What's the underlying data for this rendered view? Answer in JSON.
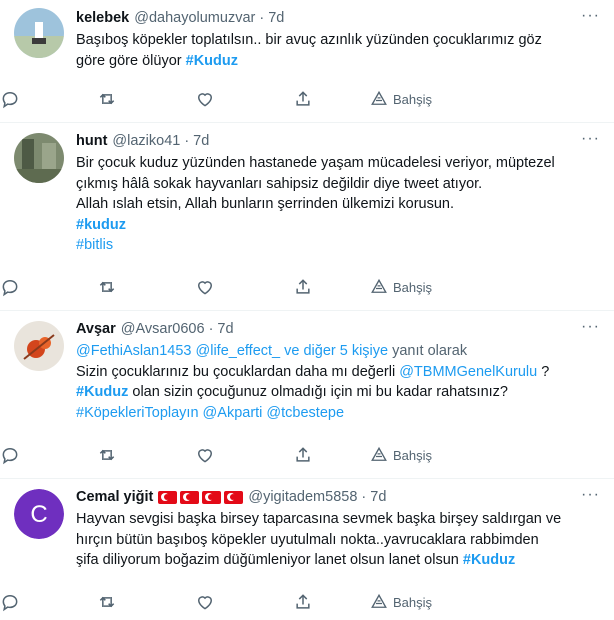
{
  "tweets": [
    {
      "name": "kelebek",
      "handle": "@dahayolumuzvar",
      "time": "7d",
      "lines": [
        [
          {
            "t": "Başıboş köpekler toplatılsın.. bir avuç azınlık yüzünden çocuklarımız göz"
          }
        ],
        [
          {
            "t": "göre göre ölüyor "
          },
          {
            "t": "#Kuduz",
            "link": true,
            "bold": true
          }
        ]
      ]
    },
    {
      "name": "hunt",
      "handle": "@laziko41",
      "time": "7d",
      "lines": [
        [
          {
            "t": "Bir çocuk kuduz yüzünden hastanede yaşam mücadelesi veriyor, müptezel"
          }
        ],
        [
          {
            "t": "çıkmış hâlâ sokak hayvanları sahipsiz değildir diye tweet atıyor."
          }
        ],
        [
          {
            "t": "Allah ıslah etsin, Allah bunların şerrinden ülkemizi korusun."
          }
        ],
        [
          {
            "t": "#kuduz",
            "link": true,
            "bold": true
          }
        ],
        [
          {
            "t": "#bitlis",
            "link": true
          }
        ]
      ]
    },
    {
      "name": "Avşar",
      "handle": "@Avsar0606",
      "time": "7d",
      "lines": [
        [
          {
            "t": "@FethiAslan1453 @life_effect_  ve diğer 5 kişiye",
            "link": true
          },
          {
            "t": " yanıt olarak",
            "muted": true
          }
        ],
        [
          {
            "t": "Sizin çocuklarınız bu çocuklardan daha mı değerli "
          },
          {
            "t": "@TBMMGenelKurulu",
            "link": true
          },
          {
            "t": " ?"
          }
        ],
        [
          {
            "t": "#Kuduz",
            "link": true,
            "bold": true
          },
          {
            "t": " olan sizin çocuğunuz olmadığı için mi bu kadar rahatsınız?"
          }
        ],
        [
          {
            "t": "#KöpekleriToplayın @Akparti @tcbestepe",
            "link": true
          }
        ]
      ]
    },
    {
      "name": "Cemal yiğit",
      "handle": "@yigitadem5858",
      "time": "7d",
      "avatar_letter": "C",
      "lines": [
        [
          {
            "t": "Hayvan sevgisi başka birsey taparcasına sevmek başka birşey saldırgan ve"
          }
        ],
        [
          {
            "t": "hırçın bütün başıboş köpekler uyutulmalı nokta..yavrucaklara rabbimden"
          }
        ],
        [
          {
            "t": "şifa diliyorum boğazim düğümleniyor lanet olsun lanet olsun "
          },
          {
            "t": "#Kuduz",
            "link": true,
            "bold": true
          }
        ]
      ]
    }
  ],
  "actions": {
    "share_label": "Bahşiş"
  },
  "colors": {
    "link": "#1d9bf0",
    "muted": "#536471",
    "avatar_purple": "#6f2fbf"
  }
}
